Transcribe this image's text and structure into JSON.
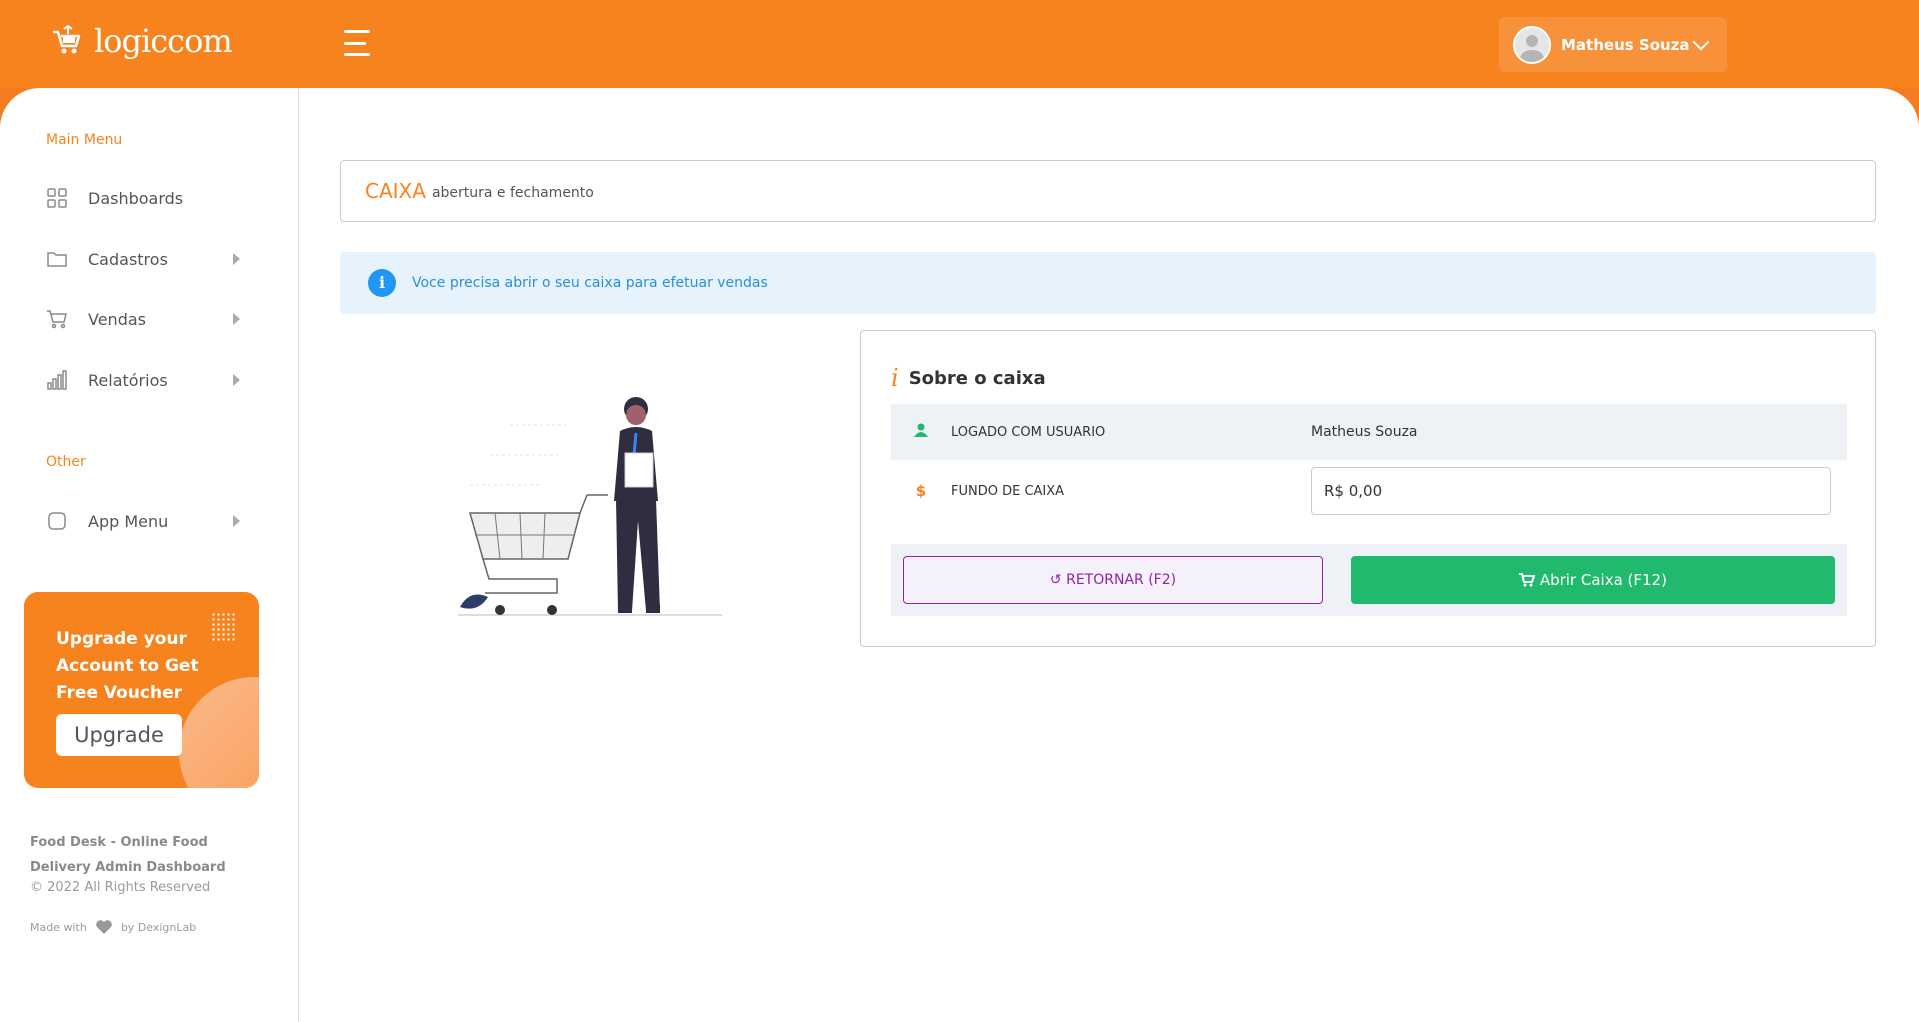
{
  "header": {
    "brand": "logiccom",
    "user_name": "Matheus Souza"
  },
  "sidebar": {
    "main_menu_title": "Main Menu",
    "items": [
      {
        "label": "Dashboards",
        "icon": "grid-icon"
      },
      {
        "label": "Cadastros",
        "icon": "folder-icon"
      },
      {
        "label": "Vendas",
        "icon": "cart-icon"
      },
      {
        "label": "Relatórios",
        "icon": "bar-chart-icon"
      }
    ],
    "other_title": "Other",
    "other_items": [
      {
        "label": "App Menu",
        "icon": "square-icon"
      }
    ],
    "upgrade": {
      "text": "Upgrade your Account to Get Free Voucher",
      "button": "Upgrade"
    },
    "footer": {
      "title": "Food Desk - Online Food Delivery Admin Dashboard",
      "copyright": "© 2022 All Rights Reserved",
      "made_with": "Made with",
      "by": "by DexignLab"
    }
  },
  "page": {
    "title": "CAIXA",
    "subtitle": "abertura e fechamento",
    "alert": "Voce precisa abrir o seu caixa para efetuar vendas"
  },
  "caixa_box": {
    "title": "Sobre o caixa",
    "rows": [
      {
        "label": "LOGADO COM USUARIO",
        "value": "Matheus Souza"
      },
      {
        "label": "FUNDO DE CAIXA",
        "value": "R$ 0,00"
      }
    ],
    "btn_return": "RETORNAR (F2)",
    "btn_open": "Abrir Caixa (F12)"
  },
  "colors": {
    "brand": "#f7831f",
    "info": "#2196f3",
    "success": "#20b96d",
    "purple": "#8e24aa"
  }
}
